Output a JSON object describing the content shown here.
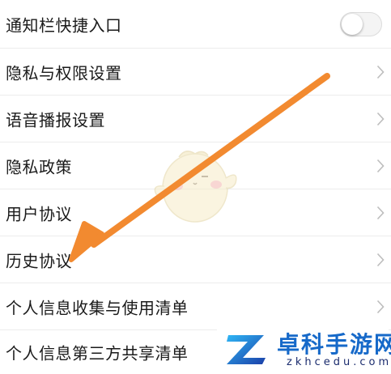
{
  "settings": {
    "notification_shortcut": {
      "label": "通知栏快捷入口",
      "toggle_on": false
    },
    "privacy_permissions": {
      "label": "隐私与权限设置"
    },
    "voice_broadcast": {
      "label": "语音播报设置"
    },
    "privacy_policy": {
      "label": "隐私政策"
    },
    "user_agreement": {
      "label": "用户协议"
    },
    "history_agreement": {
      "label": "历史协议"
    },
    "personal_info_collection": {
      "label": "个人信息收集与使用清单"
    },
    "third_party_sharing": {
      "label": "个人信息第三方共享清单"
    }
  },
  "annotation": {
    "arrow_color": "#f28a30",
    "target": "历史协议"
  },
  "watermark": {
    "title": "卓科手游网",
    "url": "zkhcedu.com"
  },
  "colors": {
    "text": "#1a1a1a",
    "divider": "#ececec",
    "chevron": "#bdbdbd",
    "brand": "#1669c9"
  },
  "icons": {
    "chevron": "chevron-right-icon",
    "mascot": "mascot-icon",
    "logo": "watermark-logo-icon"
  }
}
